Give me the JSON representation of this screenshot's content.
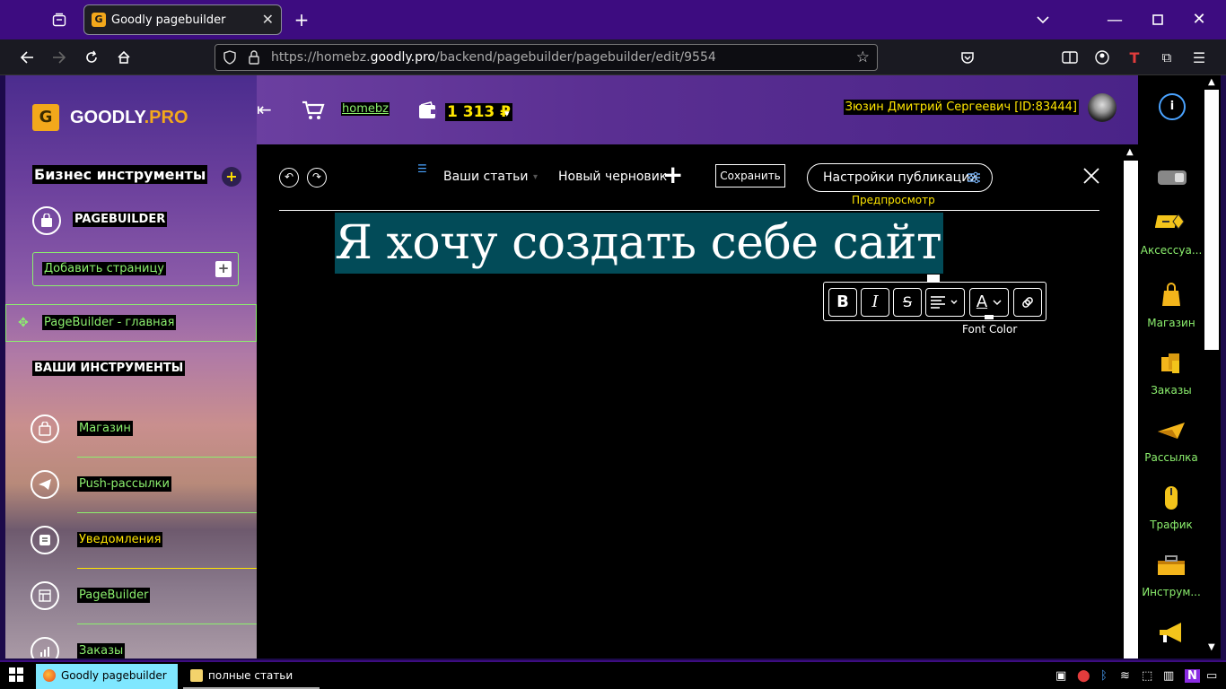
{
  "browser": {
    "tab_title": "Goodly pagebuilder",
    "url_prefix": "https://homebz.",
    "url_domain": "goodly.pro",
    "url_path": "/backend/pagebuilder/pagebuilder/edit/9554"
  },
  "sidebar": {
    "logo_text_a": "GOODLY",
    "logo_text_b": ".PRO",
    "section_title": "Бизнес инструменты",
    "section_plus": "+",
    "pagebuilder_label": "PAGEBUILDER",
    "add_page_label": "Добавить страницу",
    "add_page_plus": "+",
    "main_page_label": "PageBuilder - главная",
    "tools_title": "ВАШИ ИНСТРУМЕНТЫ",
    "items": [
      {
        "label": "Магазин"
      },
      {
        "label": "Push-рассылки"
      },
      {
        "label": "Уведомления"
      },
      {
        "label": "PageBuilder"
      },
      {
        "label": "Заказы"
      }
    ]
  },
  "header": {
    "shop_link": "homebz",
    "balance": "1 313 ₽",
    "user_name": "Зюзин Дмитрий Сергеевич [ID:83444]"
  },
  "editor": {
    "your_articles": "Ваши статьи",
    "new_draft": "Новый черновик",
    "save": "Сохранить",
    "publish_settings": "Настройки публикации",
    "preview": "Предпросмотр",
    "headline": "Я хочу создать себе сайт",
    "tooltip": "Font Color",
    "format_buttons": {
      "bold": "B",
      "italic": "I",
      "strike": "S",
      "color": "A"
    }
  },
  "right_sidebar": {
    "items": [
      {
        "label": "Аксессуа...",
        "icon": "accessories-icon"
      },
      {
        "label": "Магазин",
        "icon": "shop-bag-icon"
      },
      {
        "label": "Заказы",
        "icon": "orders-icon"
      },
      {
        "label": "Рассылка",
        "icon": "mailing-icon"
      },
      {
        "label": "Трафик",
        "icon": "traffic-icon"
      },
      {
        "label": "Инструм...",
        "icon": "tools-icon"
      }
    ]
  },
  "taskbar": {
    "items": [
      {
        "label": "Goodly pagebuilder — ..."
      },
      {
        "label": "полные статьи"
      }
    ]
  },
  "colors": {
    "accent_green": "#8cf06e",
    "accent_yellow": "#ffe600",
    "brand_orange": "#f3a81b",
    "tab_strip": "#3d0c80",
    "headline_highlight": "#024b58"
  }
}
